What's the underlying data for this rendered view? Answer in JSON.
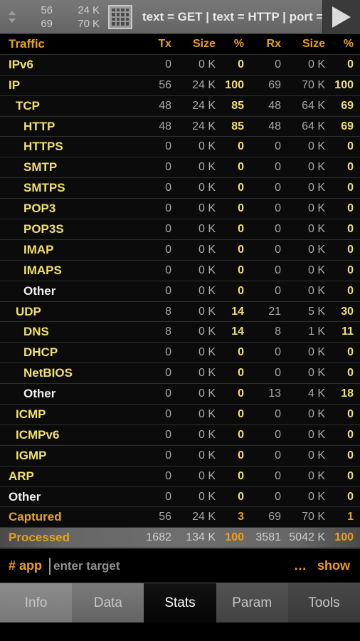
{
  "topbar": {
    "up_arrow_icon": "triangle-up-icon",
    "down_arrow_icon": "triangle-down-icon",
    "tx_count": "56",
    "rx_count": "69",
    "tx_size_num": "24",
    "tx_size_unit": "K",
    "rx_size_num": "70",
    "rx_size_unit": "K",
    "grid_icon": "grid-matrix-icon",
    "filter_text": "text = GET | text = HTTP | port = …",
    "play_icon": "play-icon"
  },
  "table": {
    "columns": [
      "Traffic",
      "Tx",
      "Size",
      "%",
      "Rx",
      "Size",
      "%"
    ],
    "rows": [
      {
        "name": "IPv6",
        "level": 0,
        "style": "yellow",
        "tx": "0",
        "tx_size": "0 K",
        "tx_pct": "0",
        "rx": "0",
        "rx_size": "0 K",
        "rx_pct": "0"
      },
      {
        "name": "IP",
        "level": 0,
        "style": "yellow",
        "tx": "56",
        "tx_size": "24 K",
        "tx_pct": "100",
        "rx": "69",
        "rx_size": "70 K",
        "rx_pct": "100"
      },
      {
        "name": "TCP",
        "level": 1,
        "style": "yellow",
        "tx": "48",
        "tx_size": "24 K",
        "tx_pct": "85",
        "rx": "48",
        "rx_size": "64 K",
        "rx_pct": "69"
      },
      {
        "name": "HTTP",
        "level": 2,
        "style": "yellow",
        "tx": "48",
        "tx_size": "24 K",
        "tx_pct": "85",
        "rx": "48",
        "rx_size": "64 K",
        "rx_pct": "69"
      },
      {
        "name": "HTTPS",
        "level": 2,
        "style": "yellow",
        "tx": "0",
        "tx_size": "0 K",
        "tx_pct": "0",
        "rx": "0",
        "rx_size": "0 K",
        "rx_pct": "0"
      },
      {
        "name": "SMTP",
        "level": 2,
        "style": "yellow",
        "tx": "0",
        "tx_size": "0 K",
        "tx_pct": "0",
        "rx": "0",
        "rx_size": "0 K",
        "rx_pct": "0"
      },
      {
        "name": "SMTPS",
        "level": 2,
        "style": "yellow",
        "tx": "0",
        "tx_size": "0 K",
        "tx_pct": "0",
        "rx": "0",
        "rx_size": "0 K",
        "rx_pct": "0"
      },
      {
        "name": "POP3",
        "level": 2,
        "style": "yellow",
        "tx": "0",
        "tx_size": "0 K",
        "tx_pct": "0",
        "rx": "0",
        "rx_size": "0 K",
        "rx_pct": "0"
      },
      {
        "name": "POP3S",
        "level": 2,
        "style": "yellow",
        "tx": "0",
        "tx_size": "0 K",
        "tx_pct": "0",
        "rx": "0",
        "rx_size": "0 K",
        "rx_pct": "0"
      },
      {
        "name": "IMAP",
        "level": 2,
        "style": "yellow",
        "tx": "0",
        "tx_size": "0 K",
        "tx_pct": "0",
        "rx": "0",
        "rx_size": "0 K",
        "rx_pct": "0"
      },
      {
        "name": "IMAPS",
        "level": 2,
        "style": "yellow",
        "tx": "0",
        "tx_size": "0 K",
        "tx_pct": "0",
        "rx": "0",
        "rx_size": "0 K",
        "rx_pct": "0"
      },
      {
        "name": "Other",
        "level": 2,
        "style": "white",
        "tx": "0",
        "tx_size": "0 K",
        "tx_pct": "0",
        "rx": "0",
        "rx_size": "0 K",
        "rx_pct": "0"
      },
      {
        "name": "UDP",
        "level": 1,
        "style": "yellow",
        "tx": "8",
        "tx_size": "0 K",
        "tx_pct": "14",
        "rx": "21",
        "rx_size": "5 K",
        "rx_pct": "30"
      },
      {
        "name": "DNS",
        "level": 2,
        "style": "yellow",
        "tx": "8",
        "tx_size": "0 K",
        "tx_pct": "14",
        "rx": "8",
        "rx_size": "1 K",
        "rx_pct": "11"
      },
      {
        "name": "DHCP",
        "level": 2,
        "style": "yellow",
        "tx": "0",
        "tx_size": "0 K",
        "tx_pct": "0",
        "rx": "0",
        "rx_size": "0 K",
        "rx_pct": "0"
      },
      {
        "name": "NetBIOS",
        "level": 2,
        "style": "yellow",
        "tx": "0",
        "tx_size": "0 K",
        "tx_pct": "0",
        "rx": "0",
        "rx_size": "0 K",
        "rx_pct": "0"
      },
      {
        "name": "Other",
        "level": 2,
        "style": "white",
        "tx": "0",
        "tx_size": "0 K",
        "tx_pct": "0",
        "rx": "13",
        "rx_size": "4 K",
        "rx_pct": "18"
      },
      {
        "name": "ICMP",
        "level": 1,
        "style": "yellow",
        "tx": "0",
        "tx_size": "0 K",
        "tx_pct": "0",
        "rx": "0",
        "rx_size": "0 K",
        "rx_pct": "0"
      },
      {
        "name": "ICMPv6",
        "level": 1,
        "style": "yellow",
        "tx": "0",
        "tx_size": "0 K",
        "tx_pct": "0",
        "rx": "0",
        "rx_size": "0 K",
        "rx_pct": "0"
      },
      {
        "name": "IGMP",
        "level": 1,
        "style": "yellow",
        "tx": "0",
        "tx_size": "0 K",
        "tx_pct": "0",
        "rx": "0",
        "rx_size": "0 K",
        "rx_pct": "0"
      },
      {
        "name": "ARP",
        "level": 0,
        "style": "yellow",
        "tx": "0",
        "tx_size": "0 K",
        "tx_pct": "0",
        "rx": "0",
        "rx_size": "0 K",
        "rx_pct": "0"
      },
      {
        "name": "Other",
        "level": 0,
        "style": "white",
        "tx": "0",
        "tx_size": "0 K",
        "tx_pct": "0",
        "rx": "0",
        "rx_size": "0 K",
        "rx_pct": "0"
      },
      {
        "name": "Captured",
        "level": 0,
        "style": "amber",
        "tx": "56",
        "tx_size": "24 K",
        "tx_pct": "3",
        "rx": "69",
        "rx_size": "70 K",
        "rx_pct": "1"
      },
      {
        "name": "Processed",
        "level": 0,
        "style": "amber",
        "highlight": true,
        "tx": "1682",
        "tx_size": "134 K",
        "tx_pct": "100",
        "rx": "3581",
        "rx_size": "5042 K",
        "rx_pct": "100"
      }
    ]
  },
  "command": {
    "prompt": "# app",
    "placeholder": "enter target",
    "value": "",
    "more_label": "…",
    "show_label": "show"
  },
  "tabs": [
    {
      "label": "Info",
      "active": false
    },
    {
      "label": "Data",
      "active": false
    },
    {
      "label": "Stats",
      "active": true
    },
    {
      "label": "Param",
      "active": false
    },
    {
      "label": "Tools",
      "active": false
    }
  ],
  "colors": {
    "amber": "#e8a317",
    "yellow": "#f2e06a",
    "grey": "#a8a8a8",
    "background": "#000000"
  }
}
